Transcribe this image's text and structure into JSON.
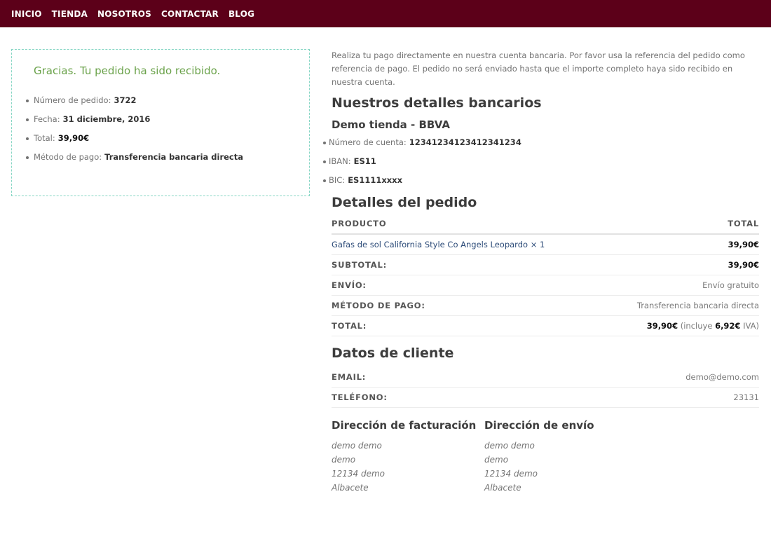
{
  "nav": {
    "items": [
      "INICIO",
      "TIENDA",
      "NOSOTROS",
      "CONTACTAR",
      "BLOG"
    ]
  },
  "thanks": {
    "message": "Gracias. Tu pedido ha sido recibido.",
    "overview": [
      {
        "label": "Número de pedido:",
        "value": "3722"
      },
      {
        "label": "Fecha:",
        "value": "31 diciembre, 2016"
      },
      {
        "label": "Total:",
        "value": "39,90€"
      },
      {
        "label": "Método de pago:",
        "value": "Transferencia bancaria directa"
      }
    ]
  },
  "bank": {
    "intro": "Realiza tu pago directamente en nuestra cuenta bancaria. Por favor usa la referencia del pedido como referencia de pago. El pedido no será enviado hasta que el importe completo haya sido recibido en nuestra cuenta.",
    "heading": "Nuestros detalles bancarios",
    "name": "Demo tienda - BBVA",
    "details": [
      {
        "label": "Número de cuenta:",
        "value": "12341234123412341234"
      },
      {
        "label": "IBAN:",
        "value": "ES11"
      },
      {
        "label": "BIC:",
        "value": "ES1111xxxx"
      }
    ]
  },
  "order": {
    "heading": "Detalles del pedido",
    "col_product": "PRODUCTO",
    "col_total": "TOTAL",
    "item": {
      "name": "Gafas de sol California Style Co Angels Leopardo",
      "qty": "× 1",
      "total": "39,90€"
    },
    "subtotal": {
      "label": "SUBTOTAL:",
      "value": "39,90€"
    },
    "shipping": {
      "label": "ENVÍO:",
      "value": "Envío gratuito"
    },
    "payment": {
      "label": "MÉTODO DE PAGO:",
      "value": "Transferencia bancaria directa"
    },
    "total": {
      "label": "TOTAL:",
      "value": "39,90€",
      "incl_pre": "(incluye",
      "tax": "6,92€",
      "incl_post": "IVA)"
    }
  },
  "customer": {
    "heading": "Datos de cliente",
    "email_label": "EMAIL:",
    "email": "demo@demo.com",
    "phone_label": "TELÉFONO:",
    "phone": "23131"
  },
  "billing": {
    "heading": "Dirección de facturación",
    "lines": [
      "demo demo",
      "demo",
      "12134 demo",
      "Albacete"
    ]
  },
  "shipping_address": {
    "heading": "Dirección de envío",
    "lines": [
      "demo demo",
      "demo",
      "12134 demo",
      "Albacete"
    ]
  }
}
